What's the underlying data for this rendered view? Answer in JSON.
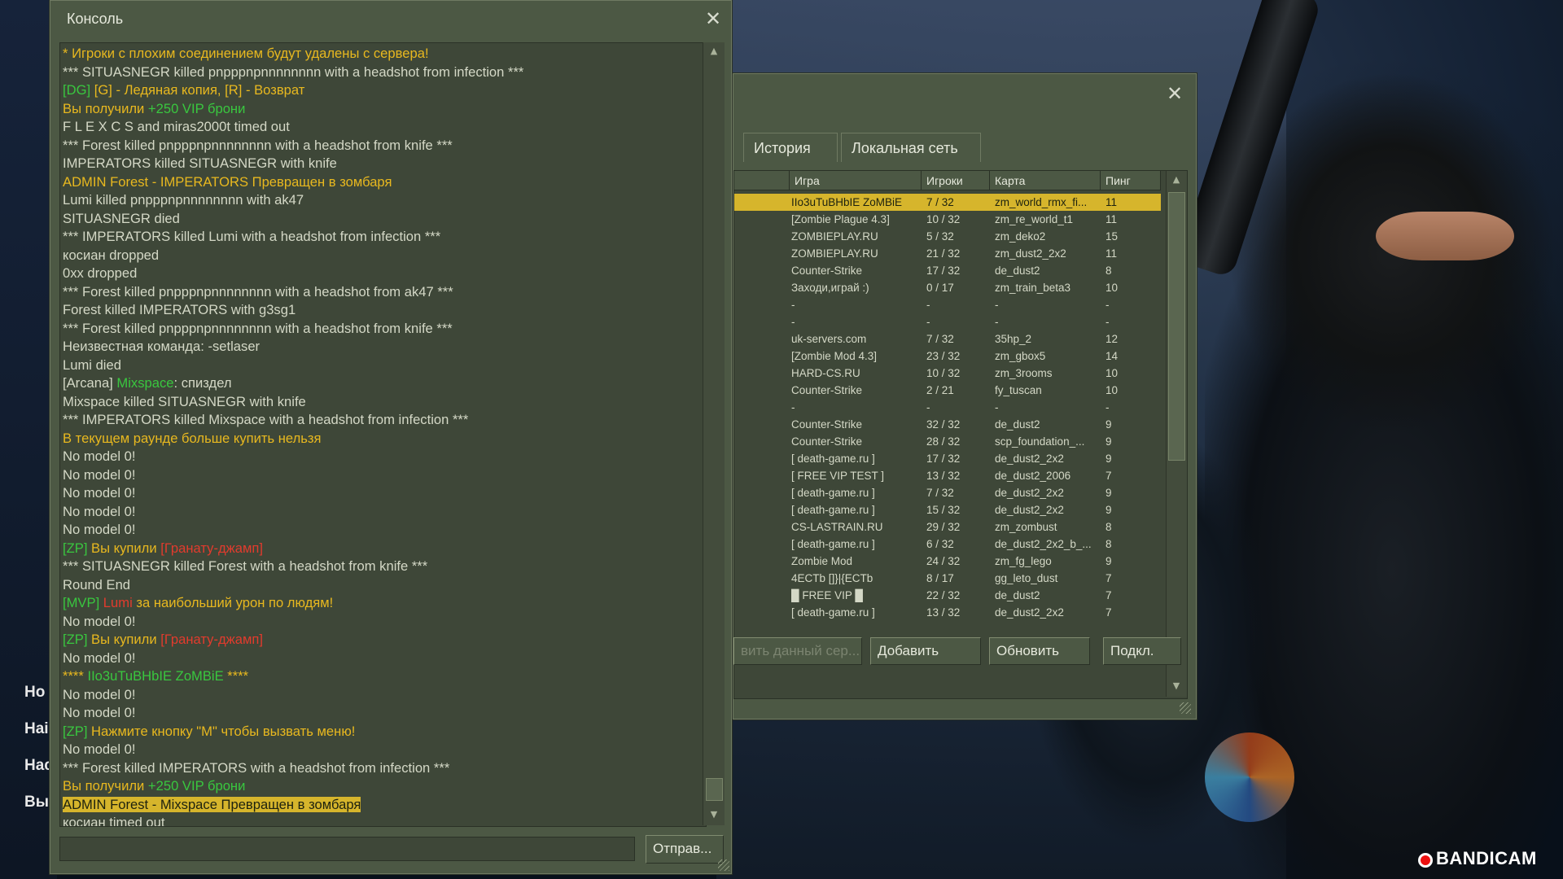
{
  "main_menu": {
    "items": [
      "Но",
      "Наі",
      "Нас",
      "Вы"
    ]
  },
  "console": {
    "title": "Консоль",
    "send_label": "Отправ...",
    "input_value": "",
    "lines": [
      [
        {
          "t": "* Игроки с плохим соединением будут удалены с сервера!",
          "c": "y"
        }
      ],
      [
        {
          "t": "*** SITUASNEGR killed pnpppnpnnnnnnnn with a headshot from infection ***",
          "c": "w"
        }
      ],
      [
        {
          "t": "[DG] ",
          "c": "g"
        },
        {
          "t": "[G] - Ледяная копия, [R] - Возврат",
          "c": "y"
        }
      ],
      [
        {
          "t": "Вы получили ",
          "c": "y"
        },
        {
          "t": "+250 VIP брони",
          "c": "g"
        }
      ],
      [
        {
          "t": "F  L  E  X  C  S and miras2000t timed out",
          "c": "w"
        }
      ],
      [
        {
          "t": "*** Forest killed pnpppnpnnnnnnnn with a headshot from knife ***",
          "c": "w"
        }
      ],
      [
        {
          "t": "IMPERATORS killed SITUASNEGR with knife",
          "c": "w"
        }
      ],
      [
        {
          "t": "ADMIN Forest - IMPERATORS Превращен в зомбаря",
          "c": "y"
        }
      ],
      [
        {
          "t": "Lumi killed pnpppnpnnnnnnnn with ak47",
          "c": "w"
        }
      ],
      [
        {
          "t": "SITUASNEGR died",
          "c": "w"
        }
      ],
      [
        {
          "t": "*** IMPERATORS killed Lumi with a headshot from infection ***",
          "c": "w"
        }
      ],
      [
        {
          "t": "косиан dropped",
          "c": "w"
        }
      ],
      [
        {
          "t": "0xx dropped",
          "c": "w"
        }
      ],
      [
        {
          "t": "*** Forest killed pnpppnpnnnnnnnn with a headshot from ak47 ***",
          "c": "w"
        }
      ],
      [
        {
          "t": "Forest killed IMPERATORS with g3sg1",
          "c": "w"
        }
      ],
      [
        {
          "t": "*** Forest killed pnpppnpnnnnnnnn with a headshot from knife ***",
          "c": "w"
        }
      ],
      [
        {
          "t": "Неизвестная команда: -setlaser",
          "c": "w"
        }
      ],
      [
        {
          "t": "Lumi died",
          "c": "w"
        }
      ],
      [
        {
          "t": "[Arcana] ",
          "c": "w"
        },
        {
          "t": "Mixspace",
          "c": "g"
        },
        {
          "t": ": спиздел",
          "c": "w"
        }
      ],
      [
        {
          "t": "Mixspace killed SITUASNEGR with knife",
          "c": "w"
        }
      ],
      [
        {
          "t": "*** IMPERATORS killed Mixspace with a headshot from infection ***",
          "c": "w"
        }
      ],
      [
        {
          "t": "В текущем раунде больше купить нельзя",
          "c": "y"
        }
      ],
      [
        {
          "t": "No model 0!",
          "c": "w"
        }
      ],
      [
        {
          "t": "No model 0!",
          "c": "w"
        }
      ],
      [
        {
          "t": "No model 0!",
          "c": "w"
        }
      ],
      [
        {
          "t": "No model 0!",
          "c": "w"
        }
      ],
      [
        {
          "t": "No model 0!",
          "c": "w"
        }
      ],
      [
        {
          "t": "[ZP] ",
          "c": "g"
        },
        {
          "t": "Вы купили ",
          "c": "y"
        },
        {
          "t": "[Гранату-джамп]",
          "c": "r"
        }
      ],
      [
        {
          "t": "*** SITUASNEGR killed Forest with a headshot from knife ***",
          "c": "w"
        }
      ],
      [
        {
          "t": "Round End",
          "c": "w"
        }
      ],
      [
        {
          "t": "[MVP] ",
          "c": "g"
        },
        {
          "t": "Lumi",
          "c": "r"
        },
        {
          "t": " за наибольший урон по людям!",
          "c": "y"
        }
      ],
      [
        {
          "t": "No model 0!",
          "c": "w"
        }
      ],
      [
        {
          "t": "[ZP] ",
          "c": "g"
        },
        {
          "t": "Вы купили ",
          "c": "y"
        },
        {
          "t": "[Гранату-джамп]",
          "c": "r"
        }
      ],
      [
        {
          "t": "No model 0!",
          "c": "w"
        }
      ],
      [
        {
          "t": "**** ",
          "c": "y"
        },
        {
          "t": "IIo3uTuBHbIE ZoMBiE",
          "c": "g"
        },
        {
          "t": " ****",
          "c": "y"
        }
      ],
      [
        {
          "t": "No model 0!",
          "c": "w"
        }
      ],
      [
        {
          "t": "No model 0!",
          "c": "w"
        }
      ],
      [
        {
          "t": "[ZP] ",
          "c": "g"
        },
        {
          "t": "Нажмите кнопку \"M\" чтобы вызвать меню!",
          "c": "y"
        }
      ],
      [
        {
          "t": "No model 0!",
          "c": "w"
        }
      ],
      [
        {
          "t": "*** Forest killed IMPERATORS with a headshot from infection ***",
          "c": "w"
        }
      ],
      [
        {
          "t": "Вы получили ",
          "c": "y"
        },
        {
          "t": "+250 VIP брони",
          "c": "g"
        }
      ],
      [
        {
          "t": "ADMIN Forest - Mixspace Превращен в зомбаря",
          "c": "hl"
        }
      ],
      [
        {
          "t": "косиан timed out",
          "c": "w"
        }
      ]
    ]
  },
  "browser": {
    "tabs": [
      "История",
      "Локальная сеть"
    ],
    "columns": [
      "Игра",
      "Игроки",
      "Карта",
      "Пинг"
    ],
    "rows": [
      [
        "IIo3uTuBHbIE ZoMBiE",
        "7 / 32",
        "zm_world_rmx_fi...",
        "11"
      ],
      [
        "[Zombie Plague 4.3]",
        "10 / 32",
        "zm_re_world_t1",
        "11"
      ],
      [
        "ZOMBIEPLAY.RU",
        "5 / 32",
        "zm_deko2",
        "15"
      ],
      [
        "ZOMBIEPLAY.RU",
        "21 / 32",
        "zm_dust2_2x2",
        "11"
      ],
      [
        "Counter-Strike",
        "17 / 32",
        "de_dust2",
        "8"
      ],
      [
        "Заходи,играй :)",
        "0 / 17",
        "zm_train_beta3",
        "10"
      ],
      [
        "-",
        "-",
        "-",
        "-"
      ],
      [
        "-",
        "-",
        "-",
        "-"
      ],
      [
        "uk-servers.com",
        "7 / 32",
        "35hp_2",
        "12"
      ],
      [
        "[Zombie Mod 4.3]",
        "23 / 32",
        "zm_gbox5",
        "14"
      ],
      [
        "HARD-CS.RU",
        "10 / 32",
        "zm_3rooms",
        "10"
      ],
      [
        "Counter-Strike",
        "2 / 21",
        "fy_tuscan",
        "10"
      ],
      [
        "-",
        "-",
        "-",
        "-"
      ],
      [
        "Counter-Strike",
        "32 / 32",
        "de_dust2",
        "9"
      ],
      [
        "Counter-Strike",
        "28 / 32",
        "scp_foundation_...",
        "9"
      ],
      [
        "[ death-game.ru ]",
        "17 / 32",
        "de_dust2_2x2",
        "9"
      ],
      [
        "[ FREE VIP TEST ]",
        "13 / 32",
        "de_dust2_2006",
        "7"
      ],
      [
        "[ death-game.ru ]",
        "7 / 32",
        "de_dust2_2x2",
        "9"
      ],
      [
        "[ death-game.ru ]",
        "15 / 32",
        "de_dust2_2x2",
        "9"
      ],
      [
        "CS-LASTRAIN.RU",
        "29 / 32",
        "zm_zombust",
        "8"
      ],
      [
        "[ death-game.ru ]",
        "6 / 32",
        "de_dust2_2x2_b_...",
        "8"
      ],
      [
        "Zombie Mod",
        "24 / 32",
        "zm_fg_lego",
        "9"
      ],
      [
        "4ECTb []}|{ECTb",
        "8 / 17",
        "gg_leto_dust",
        "7"
      ],
      [
        "█  FREE  VIP  █",
        "22 / 32",
        "de_dust2",
        "7"
      ],
      [
        "[ death-game.ru ]",
        "13 / 32",
        "de_dust2_2x2",
        "7"
      ]
    ],
    "selected_row": 0,
    "buttons": {
      "add_current": "вить данный сер...",
      "add": "Добавить",
      "refresh": "Обновить",
      "connect": "Подкл."
    }
  },
  "watermark": {
    "label": "BANDICAM"
  }
}
